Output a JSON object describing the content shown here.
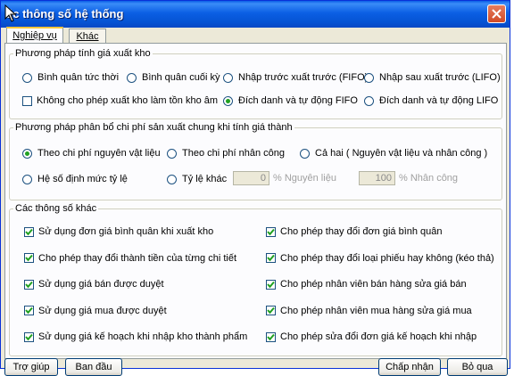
{
  "window": {
    "title": "ác thông số hệ thống"
  },
  "tabs": [
    {
      "label": "Nghiệp vụ",
      "active": true
    },
    {
      "label": "Khác",
      "active": false
    }
  ],
  "costing_method": {
    "legend": "Phương pháp tính giá xuất kho",
    "options": [
      {
        "label": "Bình quân tức thời",
        "selected": false
      },
      {
        "label": "Bình quân cuối kỳ",
        "selected": false
      },
      {
        "label": "Nhập trước xuất trước (FIFO)",
        "selected": false
      },
      {
        "label": "Nhập sau xuất trước (LIFO)",
        "selected": false
      },
      {
        "label": "Đích danh và tự  động FIFO",
        "selected": true
      },
      {
        "label": "Đích danh và tự động LIFO",
        "selected": false
      }
    ],
    "checkbox_label": "Không cho phép xuất kho làm tồn kho âm",
    "checkbox_checked": false
  },
  "allocation": {
    "legend": "Phương pháp phân bổ chi phí sản xuất chung khi tính giá thành",
    "options": [
      {
        "label": "Theo chi phí nguyên vật liệu",
        "selected": true
      },
      {
        "label": "Theo chi phí nhân công",
        "selected": false
      },
      {
        "label": "Cả hai ( Nguyên vật liệu và nhân công )",
        "selected": false
      },
      {
        "label": "Hệ số định mức tỷ lệ",
        "selected": false
      },
      {
        "label": "Tỷ lệ khác",
        "selected": false
      }
    ],
    "material_value": "0",
    "material_label": "% Nguyên liệu",
    "labor_value": "100",
    "labor_label": "% Nhân công"
  },
  "other": {
    "legend": "Các thông số khác",
    "left": [
      {
        "label": "Sử dụng đơn giá bình quân khi xuất kho",
        "checked": true
      },
      {
        "label": "Cho phép thay đổi thành tiền của từng chi tiết",
        "checked": true
      },
      {
        "label": "Sử dụng giá bán được duyệt",
        "checked": true
      },
      {
        "label": "Sử dụng giá mua được duyệt",
        "checked": true
      },
      {
        "label": "Sử dụng giá kế hoạch khi nhập kho thành phẩm",
        "checked": true
      }
    ],
    "right": [
      {
        "label": "Cho phép thay đổi đơn giá bình quân",
        "checked": true
      },
      {
        "label": "Cho phép thay đổi loại phiếu hay không (kéo thả)",
        "checked": true
      },
      {
        "label": "Cho phép nhân viên bán hàng sửa giá bán",
        "checked": true
      },
      {
        "label": "Cho phép nhân viên mua hàng sửa giá mua",
        "checked": true
      },
      {
        "label": "Cho phép sửa đổi đơn giá kế hoạch khi nhập",
        "checked": true
      }
    ]
  },
  "buttons": {
    "help": "Trợ giúp",
    "default": "Ban đầu",
    "ok": "Chấp nhận",
    "cancel": "Bỏ qua"
  }
}
